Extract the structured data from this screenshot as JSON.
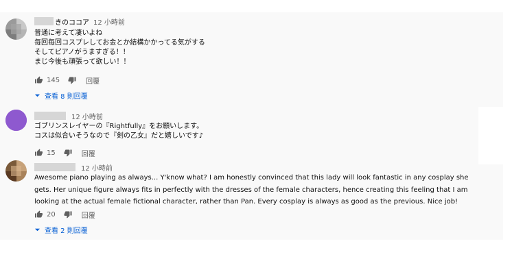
{
  "comments": [
    {
      "name_suffix": "きのココア",
      "time": "12 小時前",
      "lines": [
        "普通に考えて凄いよね",
        "毎回毎回コスプレしてお金とか結構かかってる気がする",
        "そしてピアノがうますぎる！！",
        "まじ今後も頑張って欲しい！！"
      ],
      "likes": "145",
      "reply": "回覆",
      "view_replies": "查看 8 則回覆",
      "avatar_colors": [
        "#9a9a9a",
        "#c9c9c9",
        "#7d7d7d",
        "#b5b5b5"
      ]
    },
    {
      "name_suffix": "",
      "time": "12 小時前",
      "lines": [
        "ゴブリンスレイヤーの『Rightfully』をお願いします。",
        "コスは似合いそうなので『剣の乙女』だと嬉しいです♪"
      ],
      "likes": "15",
      "reply": "回覆",
      "avatar_colors": [
        "#8e59cf"
      ]
    },
    {
      "name_suffix": "",
      "time": "12 小時前",
      "text": "Awesome piano playing as always... Y'know what? I am honestly convinced that this lady will look fantastic in any cosplay she gets. Her unique figure always fits in perfectly with the dresses of the female characters, hence creating this feeling that I am looking at the actual female fictional character, rather than Pan. Every cosplay is always as good as the previous. Nice job!",
      "likes": "20",
      "reply": "回覆",
      "view_replies": "查看 2 則回覆",
      "avatar_colors": [
        "#7a5a3a",
        "#c7a27a",
        "#5a3a22",
        "#a8825a"
      ]
    }
  ]
}
